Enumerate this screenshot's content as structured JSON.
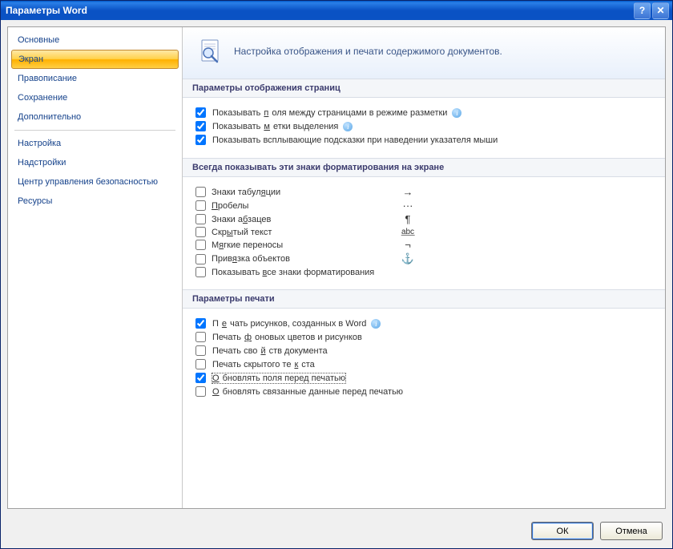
{
  "window": {
    "title": "Параметры Word"
  },
  "sidebar": {
    "items": [
      {
        "label": "Основные"
      },
      {
        "label": "Экран"
      },
      {
        "label": "Правописание"
      },
      {
        "label": "Сохранение"
      },
      {
        "label": "Дополнительно"
      },
      {
        "label": "Настройка"
      },
      {
        "label": "Надстройки"
      },
      {
        "label": "Центр управления безопасностью"
      },
      {
        "label": "Ресурсы"
      }
    ],
    "selected_index": 1
  },
  "banner": {
    "text": "Настройка отображения и печати содержимого документов."
  },
  "sections": {
    "display": {
      "title": "Параметры отображения страниц",
      "items": [
        {
          "checked": true,
          "pre": "Показывать ",
          "u": "п",
          "post": "оля между страницами в режиме разметки",
          "info": true
        },
        {
          "checked": true,
          "pre": "Показывать ",
          "u": "м",
          "post": "етки выделения",
          "info": true
        },
        {
          "checked": true,
          "pre": "Показывать всплывающие подсказки при наведении указателя мыши",
          "u": "",
          "post": "",
          "info": false
        }
      ]
    },
    "marks": {
      "title": "Всегда показывать эти знаки форматирования на экране",
      "items": [
        {
          "checked": false,
          "pre": "Знаки табул",
          "u": "я",
          "post": "ции",
          "symbol": "→"
        },
        {
          "checked": false,
          "pre": "",
          "u": "П",
          "post": "робелы",
          "symbol": "···"
        },
        {
          "checked": false,
          "pre": "Знаки а",
          "u": "б",
          "post": "зацев",
          "symbol": "¶"
        },
        {
          "checked": false,
          "pre": "Скр",
          "u": "ы",
          "post": "тый текст",
          "symbol": "a̲b̲c̲"
        },
        {
          "checked": false,
          "pre": "М",
          "u": "я",
          "post": "гкие переносы",
          "symbol": "¬"
        },
        {
          "checked": false,
          "pre": "Прив",
          "u": "я",
          "post": "зка объектов",
          "symbol": "⚓"
        },
        {
          "checked": false,
          "pre": "Показывать ",
          "u": "в",
          "post": "се знаки форматирования",
          "symbol": ""
        }
      ]
    },
    "print": {
      "title": "Параметры печати",
      "items": [
        {
          "checked": true,
          "pre": "П",
          "u": "е",
          "post": "чать рисунков, созданных в Word",
          "info": true
        },
        {
          "checked": false,
          "pre": "Печать ",
          "u": "ф",
          "post": "оновых цветов и рисунков",
          "info": false
        },
        {
          "checked": false,
          "pre": "Печать сво",
          "u": "й",
          "post": "ств документа",
          "info": false
        },
        {
          "checked": false,
          "pre": "Печать скрытого те",
          "u": "к",
          "post": "ста",
          "info": false
        },
        {
          "checked": true,
          "pre": "",
          "u": "О",
          "post": "бновлять поля перед печатью",
          "info": false,
          "focused": true
        },
        {
          "checked": false,
          "pre": "",
          "u": "О",
          "post": "бновлять связанные данные перед печатью",
          "info": false
        }
      ]
    }
  },
  "buttons": {
    "ok": "ОК",
    "cancel": "Отмена"
  }
}
